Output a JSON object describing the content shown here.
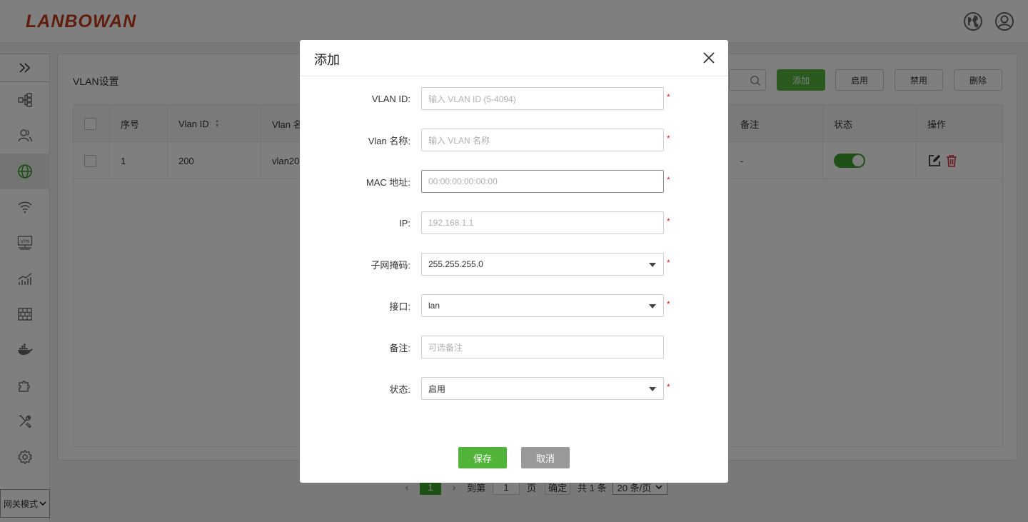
{
  "header": {
    "logo": "LANBOWAN",
    "language_icon": "globe-icon",
    "user_icon": "user-circle-icon"
  },
  "sidebar": {
    "collapse_icon": "double-chevron-right-icon",
    "items": [
      {
        "icon": "network-topology-icon",
        "active": false
      },
      {
        "icon": "users-icon",
        "active": false
      },
      {
        "icon": "globe-network-icon",
        "active": true
      },
      {
        "icon": "wifi-icon",
        "active": false
      },
      {
        "icon": "vpn-icon",
        "active": false
      },
      {
        "icon": "line-chart-icon",
        "active": false
      },
      {
        "icon": "firewall-icon",
        "active": false
      },
      {
        "icon": "docker-icon",
        "active": false
      },
      {
        "icon": "puzzle-icon",
        "active": false
      },
      {
        "icon": "tools-icon",
        "active": false
      },
      {
        "icon": "gear-icon",
        "active": false
      }
    ],
    "mode_select": "网关模式"
  },
  "panel": {
    "title": "VLAN设置",
    "buttons": {
      "add": "添加",
      "enable": "启用",
      "disable": "禁用",
      "delete": "删除"
    }
  },
  "table": {
    "columns": {
      "index": "序号",
      "vlan_id": "Vlan ID",
      "vlan_name": "Vlan 名",
      "note": "备注",
      "status": "状态",
      "actions": "操作"
    },
    "rows": [
      {
        "index": "1",
        "vlan_id": "200",
        "vlan_name": "vlan20",
        "note": "-",
        "status_on": true
      }
    ]
  },
  "pagination": {
    "current_page": "1",
    "goto_label": "到第",
    "goto_value": "1",
    "page_suffix": "页",
    "confirm": "确定",
    "total": "共 1 条",
    "per_page": "20 条/页"
  },
  "modal": {
    "title": "添加",
    "fields": {
      "vlan_id": {
        "label": "VLAN ID:",
        "placeholder": "输入 VLAN ID (5-4094)"
      },
      "vlan_name": {
        "label": "Vlan 名称:",
        "placeholder": "输入 VLAN 名称"
      },
      "mac": {
        "label": "MAC 地址:",
        "placeholder": "00:00:00:00:00:00"
      },
      "ip": {
        "label": "IP:",
        "placeholder": "192.168.1.1"
      },
      "netmask": {
        "label": "子网掩码:",
        "value": "255.255.255.0"
      },
      "interface": {
        "label": "接口:",
        "value": "lan"
      },
      "note": {
        "label": "备注:",
        "placeholder": "可选备注"
      },
      "status": {
        "label": "状态:",
        "value": "启用"
      }
    },
    "required_mark": "*",
    "save": "保存",
    "cancel": "取消"
  },
  "colors": {
    "accent": "#52b33b",
    "logo": "#c0391b",
    "required": "#e02020"
  }
}
